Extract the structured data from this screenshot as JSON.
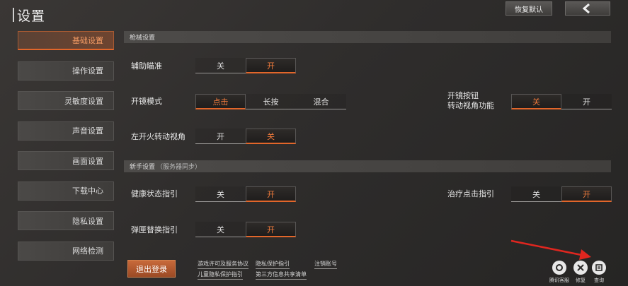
{
  "header": {
    "title": "设置",
    "restore_default": "恢复默认"
  },
  "sidebar": {
    "items": [
      {
        "label": "基础设置",
        "active": true
      },
      {
        "label": "操作设置"
      },
      {
        "label": "灵敏度设置"
      },
      {
        "label": "声音设置"
      },
      {
        "label": "画面设置"
      },
      {
        "label": "下载中心"
      },
      {
        "label": "隐私设置"
      },
      {
        "label": "网络检测"
      }
    ]
  },
  "sections": {
    "weapon": {
      "title": "枪械设置"
    },
    "newbie": {
      "title": "新手设置",
      "subtitle": "（服务器同步）"
    }
  },
  "settings": {
    "aim_assist": {
      "label": "辅助瞄准",
      "options": [
        "关",
        "开"
      ],
      "selected": "开"
    },
    "scope_mode": {
      "label": "开镜模式",
      "options": [
        "点击",
        "长按",
        "混合"
      ],
      "selected": "点击"
    },
    "scope_button_turn": {
      "label_line1": "开镜按钮",
      "label_line2": "转动视角功能",
      "options": [
        "关",
        "开"
      ],
      "selected": "关"
    },
    "left_fire_turn": {
      "label": "左开火转动视角",
      "options": [
        "开",
        "关"
      ],
      "selected": "关"
    },
    "health_guide": {
      "label": "健康状态指引",
      "options": [
        "关",
        "开"
      ],
      "selected": "开"
    },
    "heal_click_guide": {
      "label": "治疗点击指引",
      "options": [
        "关",
        "开"
      ],
      "selected": "开"
    },
    "magazine_guide": {
      "label": "弹匣替换指引",
      "options": [
        "关",
        "开"
      ],
      "selected": "开"
    }
  },
  "footer": {
    "logout": "退出登录",
    "links": {
      "license": "游戏许可及服务协议",
      "privacy": "隐私保护指引",
      "cancel_account": "注销账号",
      "child_privacy": "儿童隐私保护指引",
      "third_party": "第三方信息共享清单"
    },
    "icons": [
      {
        "label": "腾讯客服",
        "icon": "customer-service-icon"
      },
      {
        "label": "修复",
        "icon": "repair-icon"
      },
      {
        "label": "查询",
        "icon": "query-icon"
      }
    ]
  },
  "colors": {
    "accent": "#e2662a",
    "selected_text": "#ef7a3c",
    "background": "#2f2d2c"
  }
}
